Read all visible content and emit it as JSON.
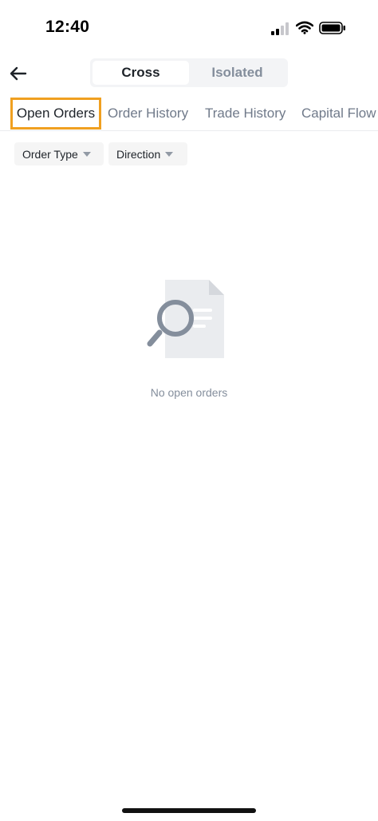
{
  "status_bar": {
    "time": "12:40",
    "icons": [
      "cellular-signal-icon",
      "wifi-icon",
      "battery-icon"
    ]
  },
  "header": {
    "back_icon": "arrow-left-icon",
    "margin_modes": [
      {
        "label": "Cross",
        "selected": true
      },
      {
        "label": "Isolated",
        "selected": false
      }
    ]
  },
  "tabs": [
    {
      "label": "Open Orders",
      "active": true
    },
    {
      "label": "Order History",
      "active": false
    },
    {
      "label": "Trade History",
      "active": false
    },
    {
      "label": "Capital Flow",
      "active": false
    }
  ],
  "filters": [
    {
      "label": "Order Type",
      "icon": "caret-down-icon"
    },
    {
      "label": "Direction",
      "icon": "caret-down-icon"
    }
  ],
  "empty_state": {
    "icon": "document-search-icon",
    "message": "No open orders"
  },
  "colors": {
    "highlight_border": "#f0a020",
    "text_primary": "#1e2329",
    "text_secondary": "#848e9c",
    "chip_background": "#f5f5f5"
  }
}
